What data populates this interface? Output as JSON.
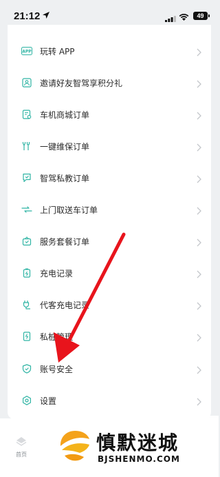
{
  "status_bar": {
    "time": "21:12",
    "battery": "49"
  },
  "menu": {
    "items": [
      {
        "label": "玩转 APP",
        "icon": "app-icon"
      },
      {
        "label": "邀请好友智驾享积分礼",
        "icon": "invite-icon"
      },
      {
        "label": "车机商城订单",
        "icon": "shop-order-icon"
      },
      {
        "label": "一键维保订单",
        "icon": "maintenance-icon"
      },
      {
        "label": "智驾私教订单",
        "icon": "tutor-icon"
      },
      {
        "label": "上门取送车订单",
        "icon": "pickup-icon"
      },
      {
        "label": "服务套餐订单",
        "icon": "package-icon"
      },
      {
        "label": "充电记录",
        "icon": "charge-record-icon"
      },
      {
        "label": "代客充电记录",
        "icon": "valet-charge-icon"
      },
      {
        "label": "私桩管理",
        "icon": "pile-icon"
      },
      {
        "label": "账号安全",
        "icon": "shield-icon"
      },
      {
        "label": "设置",
        "icon": "settings-icon"
      }
    ]
  },
  "tabbar": {
    "home_label": "首页"
  },
  "watermark": {
    "title": "慎默迷城",
    "subtitle": "BJSHENMO.COM"
  },
  "colors": {
    "accent": "#2fb4a4",
    "arrow": "#e8141c"
  }
}
